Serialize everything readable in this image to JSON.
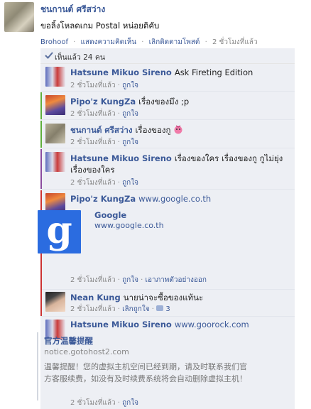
{
  "post": {
    "author": "ชนกานต์ ศรีสว่าง",
    "text": "ขอลิ้งโหลดเกม Postal หน่อยดิคับ",
    "meta": {
      "app": "Brohoof",
      "show_comments": "แสดงความคิดเห็น",
      "unfollow": "เลิกติดตามโพสต์",
      "time": "2 ชั่วโมงที่แล้ว"
    }
  },
  "likes": {
    "label": "เห็นแล้ว 24 คน"
  },
  "comments": [
    {
      "author": "Hatsune Mikuo Sireno",
      "text": "Ask Fireting Edition",
      "time": "2 ชั่วโมงที่แล้ว",
      "like": "ถูกใจ"
    },
    {
      "author": "Pipo'z KungZa",
      "text": "เรื่องของมึง ;p",
      "time": "2 ชั่วโมงที่แล้ว",
      "like": "ถูกใจ"
    },
    {
      "author": "ชนกานต์ ศรีสว่าง",
      "text": "เรื่องของกู",
      "time": "2 ชั่วโมงที่แล้ว",
      "like": "ถูกใจ"
    },
    {
      "author": "Hatsune Mikuo Sireno",
      "text": "เรื่องของใคร เรื่องของกู กูไม่ยุ่ง",
      "text2": "เรื่องของใคร",
      "time": "2 ชั่วโมงที่แล้ว",
      "like": "ถูกใจ"
    },
    {
      "author": "Pipo'z KungZa",
      "text": "www.google.co.th",
      "time": "2 ชั่วโมงที่แล้ว",
      "like": "ถูกใจ",
      "remove_preview": "เอาภาพตัวอย่างออก",
      "preview": {
        "title": "Google",
        "url": "www.google.co.th",
        "logo_letter": "g"
      }
    },
    {
      "author": "Nean Kung",
      "text": "นายน่าจะซื้อของแท้นะ",
      "time": "2 ชั่วโมงที่แล้ว",
      "unlike": "เลิกถูกใจ",
      "like_count": "3"
    },
    {
      "author": "Hatsune Mikuo Sireno",
      "text": "www.goorock.com",
      "time": "2 ชั่วโมงที่แล้ว",
      "like": "ถูกใจ",
      "attachment": {
        "title": "官方温馨提醒",
        "host": "notice.gotohost2.com",
        "description": "温馨提醒！您的虚拟主机空间已经到期，请及时联系我们官方客服续费，如没有及时续费系统将会自动删除虚拟主机！"
      }
    }
  ],
  "colors": {
    "link": "#3b5998",
    "panel": "#edeff4",
    "bar_red": "#cc3333",
    "bar_green": "#5fae3c",
    "bar_purple": "#8a4b9e"
  }
}
